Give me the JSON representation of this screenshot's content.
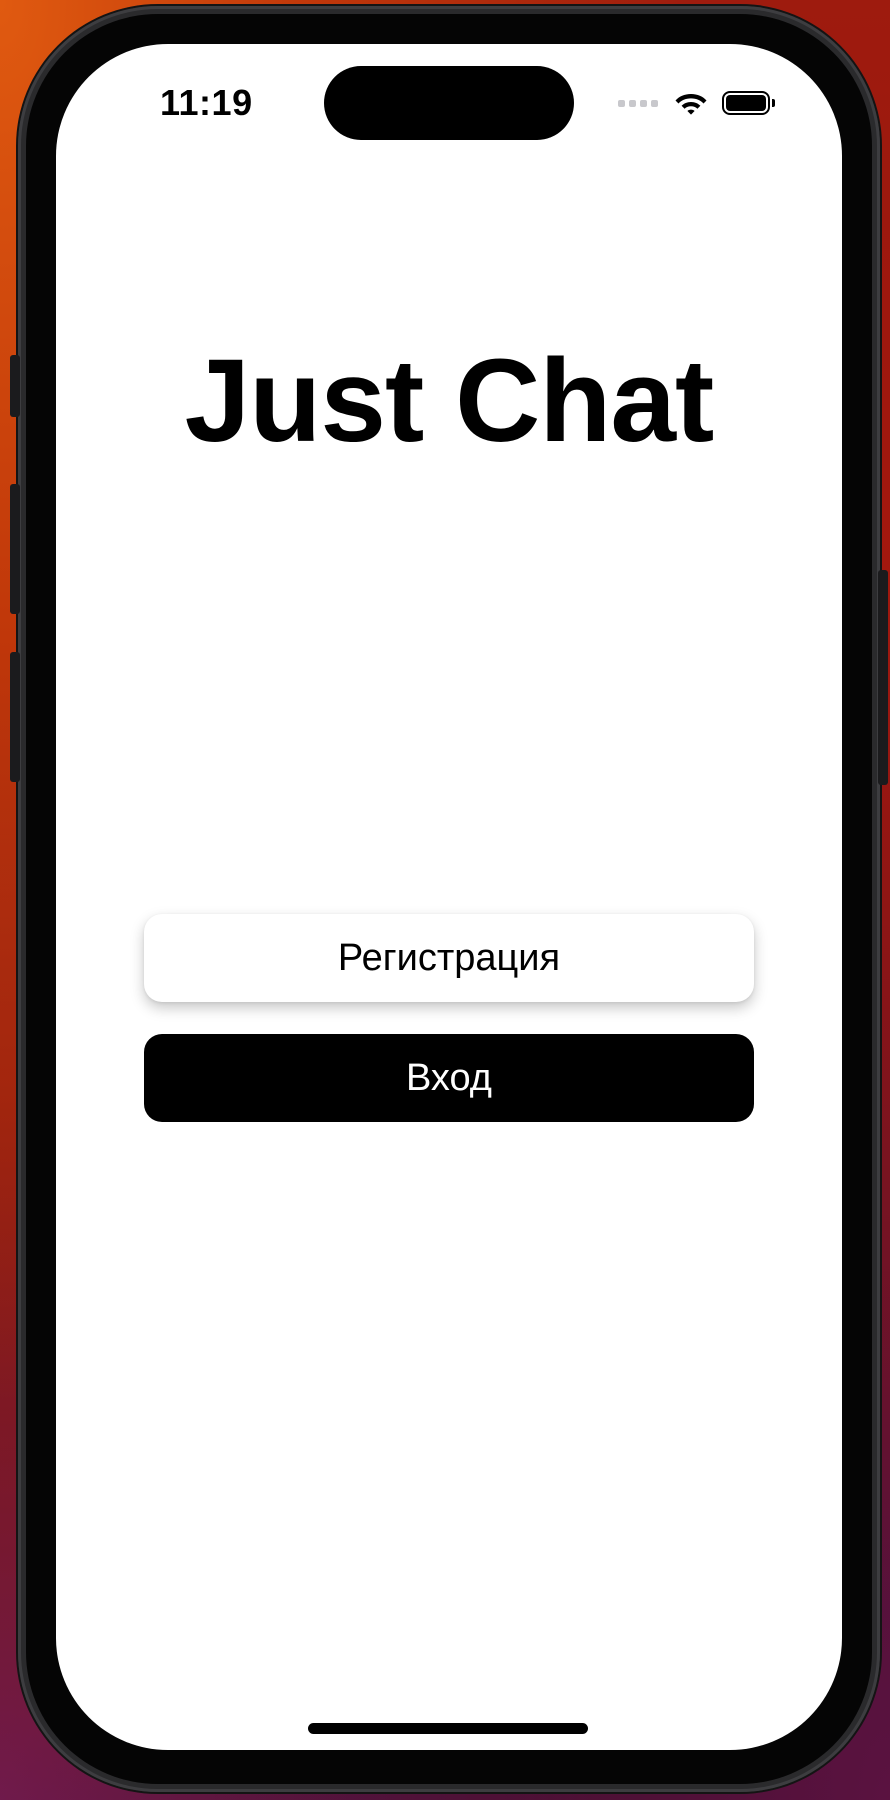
{
  "status_bar": {
    "time": "11:19",
    "icons": [
      "cellular-signal-icon",
      "wifi-icon",
      "battery-icon"
    ]
  },
  "main": {
    "title": "Just Chat",
    "register_button_label": "Регистрация",
    "login_button_label": "Вход"
  },
  "colors": {
    "primary_button_bg": "#000000",
    "secondary_button_bg": "#ffffff",
    "text": "#000000"
  }
}
